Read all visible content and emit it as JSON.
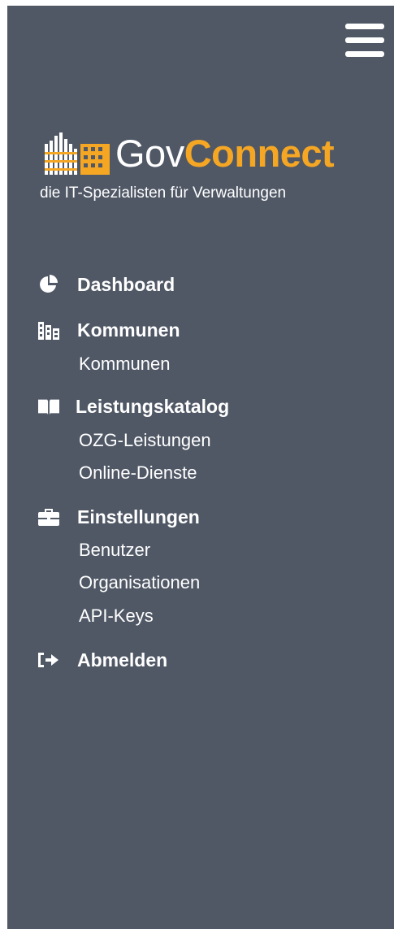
{
  "brand": {
    "name_part1": "Gov",
    "name_part2": "Connect",
    "tagline": "die IT-Spezialisten für Verwaltungen",
    "accent_color": "#f5a623"
  },
  "menu_toggle": {
    "icon": "hamburger-icon"
  },
  "colors": {
    "sidebar_bg": "#505866",
    "text": "#ffffff"
  },
  "nav": {
    "dashboard": {
      "label": "Dashboard",
      "icon": "pie-chart-icon"
    },
    "kommunen": {
      "label": "Kommunen",
      "icon": "city-icon",
      "items": [
        "Kommunen"
      ]
    },
    "leistungskatalog": {
      "label": "Leistungskatalog",
      "icon": "book-icon",
      "items": [
        "OZG-Leistungen",
        "Online-Dienste"
      ]
    },
    "einstellungen": {
      "label": "Einstellungen",
      "icon": "briefcase-icon",
      "items": [
        "Benutzer",
        "Organisationen",
        "API-Keys"
      ]
    },
    "abmelden": {
      "label": "Abmelden",
      "icon": "sign-out-icon"
    }
  }
}
